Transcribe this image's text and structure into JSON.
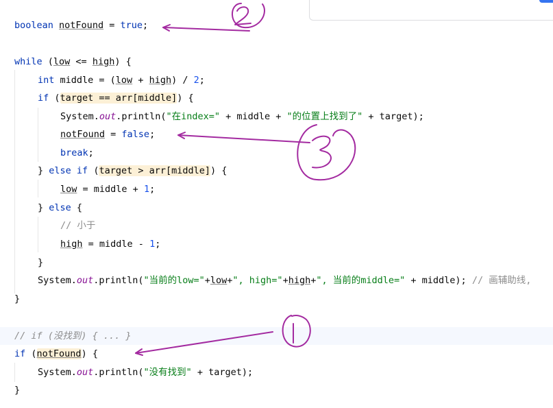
{
  "code": {
    "l1": {
      "kw": "boolean",
      "var": "notFound",
      "eq": " = ",
      "val": "true",
      "end": ";"
    },
    "l3": {
      "kw": "while",
      "open": " (",
      "low": "low",
      "op": " <= ",
      "high": "high",
      "close": ") {"
    },
    "l4": {
      "kw": "int",
      "rest1": " middle = (",
      "low": "low",
      "plus": " + ",
      "high": "high",
      "rest2": ") / ",
      "num": "2",
      "end": ";"
    },
    "l5": {
      "kw": "if",
      "open": " (",
      "cond": "target == arr[middle]",
      "close": ") {"
    },
    "l6": {
      "sys": "System.",
      "out": "out",
      "println": ".println(",
      "s1": "\"在index=\"",
      "mid": " + middle + ",
      "s2": "\"的位置上找到了\"",
      "end": " + target);"
    },
    "l7": {
      "var": "notFound",
      "eq": " = ",
      "val": "false",
      "end": ";"
    },
    "l8": {
      "kw": "break",
      "end": ";"
    },
    "l9": {
      "close": "} ",
      "kw1": "else",
      "sp": " ",
      "kw2": "if",
      "open": " (",
      "cond": "target > arr[middle]",
      "end": ") {"
    },
    "l10": {
      "low": "low",
      "rest": " = middle + ",
      "num": "1",
      "end": ";"
    },
    "l11": {
      "close": "} ",
      "kw": "else",
      "end": " {"
    },
    "l12": {
      "comment": "// 小于"
    },
    "l13": {
      "high": "high",
      "rest": " = middle - ",
      "num": "1",
      "end": ";"
    },
    "l14": {
      "close": "}"
    },
    "l15": {
      "sys": "System.",
      "out": "out",
      "println": ".println(",
      "s1": "\"当前的low=\"",
      "p1": "+",
      "low": "low",
      "p2": "+",
      "s2": "\", high=\"",
      "p3": "+",
      "high": "high",
      "p4": "+",
      "s3": "\", 当前的middle=\"",
      "end": " + middle); ",
      "comment": "// 画辅助线,"
    },
    "l16": {
      "close": "}"
    },
    "l18": {
      "comment": "// if (没找到) { ... }"
    },
    "l19": {
      "kw": "if",
      "open": " (",
      "var": "notFound",
      "end": ") {"
    },
    "l20": {
      "sys": "System.",
      "out": "out",
      "println": ".println(",
      "s1": "\"没有找到\"",
      "end": " + target);"
    },
    "l21": {
      "close": "}"
    }
  },
  "annotations": {
    "label1": "1",
    "label2": "2",
    "label3": "3",
    "color": "#a32aa0"
  }
}
